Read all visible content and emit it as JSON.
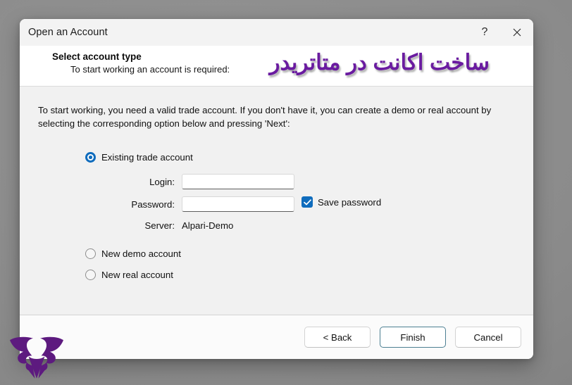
{
  "window": {
    "title": "Open an Account",
    "help_button_label": "?",
    "close_button_label": "✕"
  },
  "header": {
    "heading": "Select account type",
    "subheading": "To start working an account is required:",
    "overlay_text": "ساخت اکانت در متاتریدر",
    "overlay_color": "#6a1ba0"
  },
  "body": {
    "intro": "To start working, you need a valid trade account. If you don't have it, you can create a demo or real account by selecting the corresponding option below and pressing 'Next':",
    "options": [
      {
        "id": "existing",
        "label": "Existing trade account",
        "selected": true
      },
      {
        "id": "demo",
        "label": "New demo account",
        "selected": false
      },
      {
        "id": "real",
        "label": "New real account",
        "selected": false
      }
    ],
    "fields": {
      "login": {
        "label": "Login:",
        "value": "",
        "placeholder": ""
      },
      "password": {
        "label": "Password:",
        "value": "",
        "placeholder": ""
      },
      "server": {
        "label": "Server:",
        "value": "Alpari-Demo"
      }
    },
    "save_password": {
      "label": "Save password",
      "checked": true
    }
  },
  "footer": {
    "back_label": "< Back",
    "finish_label": "Finish",
    "cancel_label": "Cancel"
  },
  "theme": {
    "accent": "#0f6cbd",
    "default_button_border": "#4c7f92",
    "title_bar_bg": "#f3f3f3",
    "body_bg": "#f1f1f1",
    "backdrop": "#8d8d8d",
    "logo_color": "#5d1a7f"
  }
}
